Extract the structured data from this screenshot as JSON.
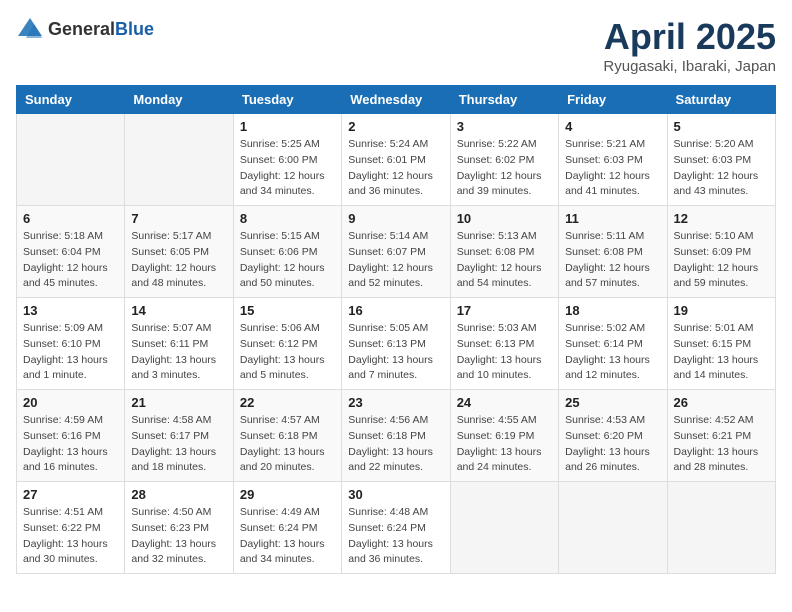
{
  "header": {
    "logo_general": "General",
    "logo_blue": "Blue",
    "month_title": "April 2025",
    "location": "Ryugasaki, Ibaraki, Japan"
  },
  "weekdays": [
    "Sunday",
    "Monday",
    "Tuesday",
    "Wednesday",
    "Thursday",
    "Friday",
    "Saturday"
  ],
  "weeks": [
    [
      {
        "day": "",
        "info": ""
      },
      {
        "day": "",
        "info": ""
      },
      {
        "day": "1",
        "info": "Sunrise: 5:25 AM\nSunset: 6:00 PM\nDaylight: 12 hours and 34 minutes."
      },
      {
        "day": "2",
        "info": "Sunrise: 5:24 AM\nSunset: 6:01 PM\nDaylight: 12 hours and 36 minutes."
      },
      {
        "day": "3",
        "info": "Sunrise: 5:22 AM\nSunset: 6:02 PM\nDaylight: 12 hours and 39 minutes."
      },
      {
        "day": "4",
        "info": "Sunrise: 5:21 AM\nSunset: 6:03 PM\nDaylight: 12 hours and 41 minutes."
      },
      {
        "day": "5",
        "info": "Sunrise: 5:20 AM\nSunset: 6:03 PM\nDaylight: 12 hours and 43 minutes."
      }
    ],
    [
      {
        "day": "6",
        "info": "Sunrise: 5:18 AM\nSunset: 6:04 PM\nDaylight: 12 hours and 45 minutes."
      },
      {
        "day": "7",
        "info": "Sunrise: 5:17 AM\nSunset: 6:05 PM\nDaylight: 12 hours and 48 minutes."
      },
      {
        "day": "8",
        "info": "Sunrise: 5:15 AM\nSunset: 6:06 PM\nDaylight: 12 hours and 50 minutes."
      },
      {
        "day": "9",
        "info": "Sunrise: 5:14 AM\nSunset: 6:07 PM\nDaylight: 12 hours and 52 minutes."
      },
      {
        "day": "10",
        "info": "Sunrise: 5:13 AM\nSunset: 6:08 PM\nDaylight: 12 hours and 54 minutes."
      },
      {
        "day": "11",
        "info": "Sunrise: 5:11 AM\nSunset: 6:08 PM\nDaylight: 12 hours and 57 minutes."
      },
      {
        "day": "12",
        "info": "Sunrise: 5:10 AM\nSunset: 6:09 PM\nDaylight: 12 hours and 59 minutes."
      }
    ],
    [
      {
        "day": "13",
        "info": "Sunrise: 5:09 AM\nSunset: 6:10 PM\nDaylight: 13 hours and 1 minute."
      },
      {
        "day": "14",
        "info": "Sunrise: 5:07 AM\nSunset: 6:11 PM\nDaylight: 13 hours and 3 minutes."
      },
      {
        "day": "15",
        "info": "Sunrise: 5:06 AM\nSunset: 6:12 PM\nDaylight: 13 hours and 5 minutes."
      },
      {
        "day": "16",
        "info": "Sunrise: 5:05 AM\nSunset: 6:13 PM\nDaylight: 13 hours and 7 minutes."
      },
      {
        "day": "17",
        "info": "Sunrise: 5:03 AM\nSunset: 6:13 PM\nDaylight: 13 hours and 10 minutes."
      },
      {
        "day": "18",
        "info": "Sunrise: 5:02 AM\nSunset: 6:14 PM\nDaylight: 13 hours and 12 minutes."
      },
      {
        "day": "19",
        "info": "Sunrise: 5:01 AM\nSunset: 6:15 PM\nDaylight: 13 hours and 14 minutes."
      }
    ],
    [
      {
        "day": "20",
        "info": "Sunrise: 4:59 AM\nSunset: 6:16 PM\nDaylight: 13 hours and 16 minutes."
      },
      {
        "day": "21",
        "info": "Sunrise: 4:58 AM\nSunset: 6:17 PM\nDaylight: 13 hours and 18 minutes."
      },
      {
        "day": "22",
        "info": "Sunrise: 4:57 AM\nSunset: 6:18 PM\nDaylight: 13 hours and 20 minutes."
      },
      {
        "day": "23",
        "info": "Sunrise: 4:56 AM\nSunset: 6:18 PM\nDaylight: 13 hours and 22 minutes."
      },
      {
        "day": "24",
        "info": "Sunrise: 4:55 AM\nSunset: 6:19 PM\nDaylight: 13 hours and 24 minutes."
      },
      {
        "day": "25",
        "info": "Sunrise: 4:53 AM\nSunset: 6:20 PM\nDaylight: 13 hours and 26 minutes."
      },
      {
        "day": "26",
        "info": "Sunrise: 4:52 AM\nSunset: 6:21 PM\nDaylight: 13 hours and 28 minutes."
      }
    ],
    [
      {
        "day": "27",
        "info": "Sunrise: 4:51 AM\nSunset: 6:22 PM\nDaylight: 13 hours and 30 minutes."
      },
      {
        "day": "28",
        "info": "Sunrise: 4:50 AM\nSunset: 6:23 PM\nDaylight: 13 hours and 32 minutes."
      },
      {
        "day": "29",
        "info": "Sunrise: 4:49 AM\nSunset: 6:24 PM\nDaylight: 13 hours and 34 minutes."
      },
      {
        "day": "30",
        "info": "Sunrise: 4:48 AM\nSunset: 6:24 PM\nDaylight: 13 hours and 36 minutes."
      },
      {
        "day": "",
        "info": ""
      },
      {
        "day": "",
        "info": ""
      },
      {
        "day": "",
        "info": ""
      }
    ]
  ]
}
